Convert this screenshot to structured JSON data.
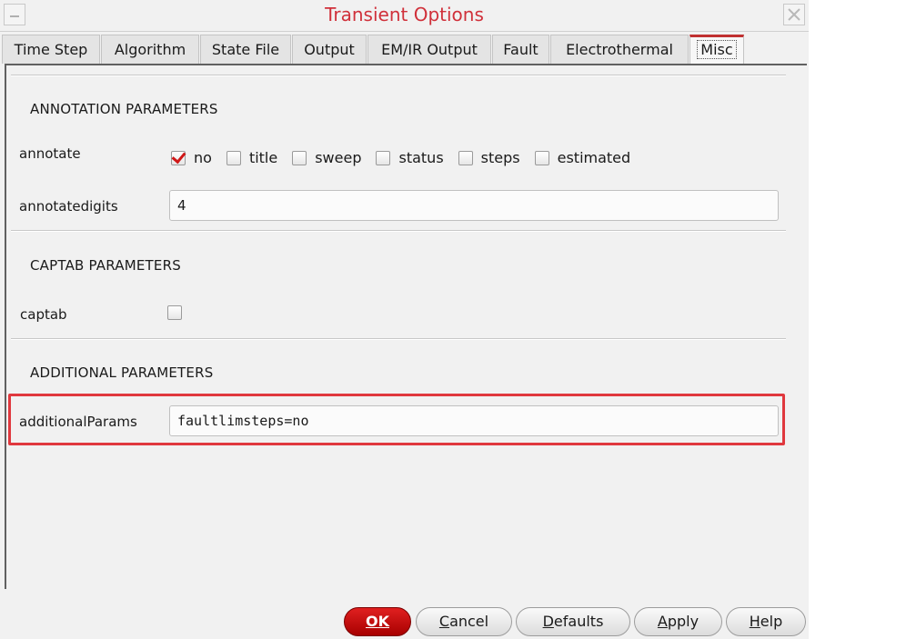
{
  "window": {
    "title": "Transient Options"
  },
  "tabs": [
    {
      "label": "Time Step"
    },
    {
      "label": "Algorithm"
    },
    {
      "label": "State File"
    },
    {
      "label": "Output"
    },
    {
      "label": "EM/IR Output"
    },
    {
      "label": "Fault"
    },
    {
      "label": "Electrothermal"
    },
    {
      "label": "Misc",
      "active": true
    }
  ],
  "annotation": {
    "section_title": "ANNOTATION PARAMETERS",
    "annotate_label": "annotate",
    "options": [
      {
        "label": "no",
        "checked": true
      },
      {
        "label": "title",
        "checked": false
      },
      {
        "label": "sweep",
        "checked": false
      },
      {
        "label": "status",
        "checked": false
      },
      {
        "label": "steps",
        "checked": false
      },
      {
        "label": "estimated",
        "checked": false
      }
    ],
    "annotatedigits_label": "annotatedigits",
    "annotatedigits_value": "4"
  },
  "captab": {
    "section_title": "CAPTAB PARAMETERS",
    "captab_label": "captab",
    "checked": false
  },
  "additional": {
    "section_title": "ADDITIONAL PARAMETERS",
    "params_label": "additionalParams",
    "params_value": "faultlimsteps=no"
  },
  "buttons": {
    "ok_mnemonic": "O",
    "ok_rest": "K",
    "cancel_mnemonic": "C",
    "cancel_rest": "ancel",
    "defaults_mnemonic": "D",
    "defaults_rest": "efaults",
    "apply_mnemonic": "A",
    "apply_rest": "pply",
    "help_mnemonic": "H",
    "help_rest": "elp"
  },
  "colors": {
    "title": "#d0303a",
    "active_tab_accent": "#c03030",
    "highlight_box": "#e0383e",
    "ok_button": "#c81010"
  }
}
